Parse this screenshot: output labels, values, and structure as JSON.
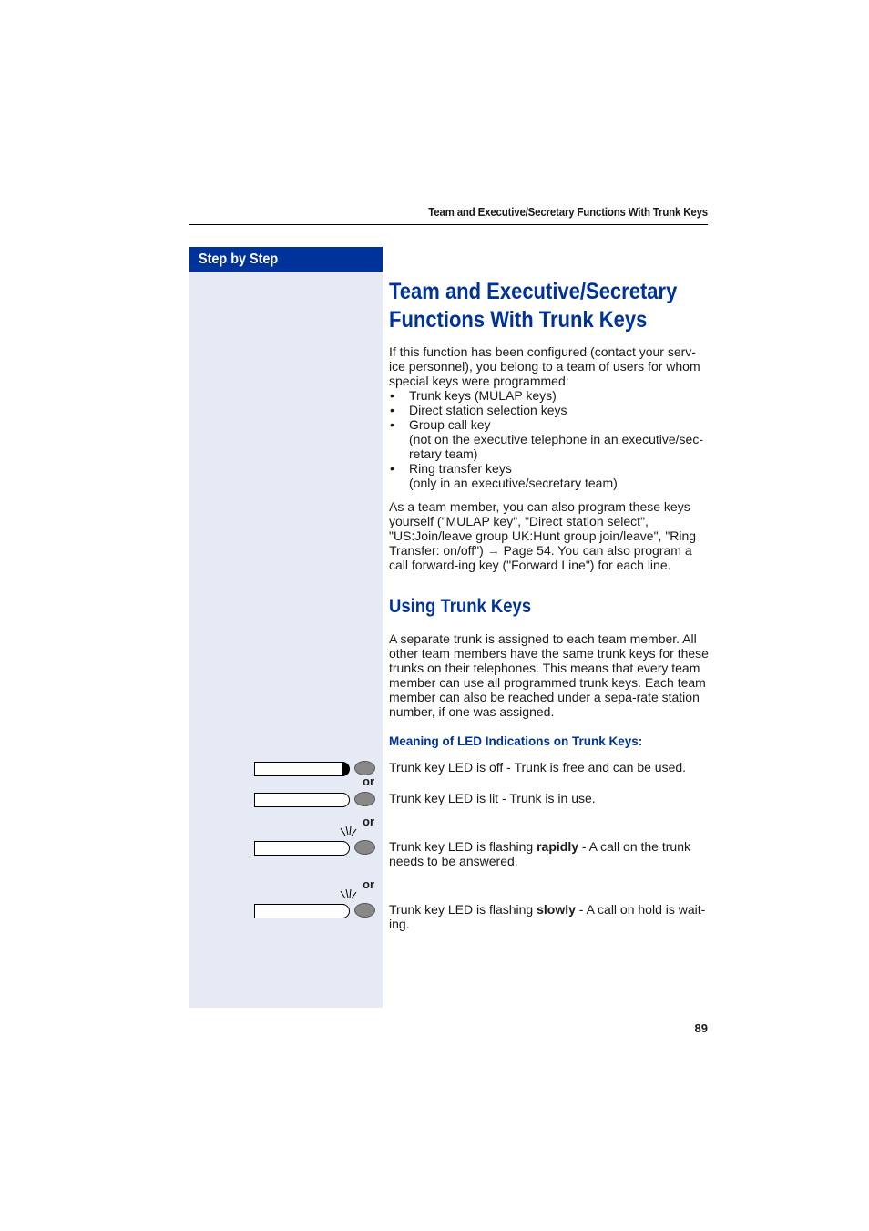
{
  "header": {
    "running_title": "Team and Executive/Secretary Functions With Trunk Keys"
  },
  "sidebar": {
    "tab_label": "Step by Step"
  },
  "section1": {
    "title_line1": "Team and Executive/Secretary",
    "title_line2": "Functions With Trunk Keys",
    "intro": "If this function has been configured (contact your serv-ice personnel), you belong to a team of users for whom special keys were programmed:",
    "bullets": [
      {
        "label": "Trunk keys (MULAP keys)",
        "sub": ""
      },
      {
        "label": "Direct station selection keys",
        "sub": ""
      },
      {
        "label": "Group call key",
        "sub": "(not on the executive telephone in an executive/sec-retary team)"
      },
      {
        "label": "Ring transfer keys",
        "sub": "(only in an executive/secretary team)"
      }
    ],
    "para2_before": "As a team member, you can also program these keys yourself (\"MULAP key\", \"Direct station select\", \"US:Join/leave group UK:Hunt group join/leave\", \"Ring Transfer: on/off\") ",
    "arrow": "→",
    "para2_after": " Page 54. You can also program a call forward-ing key (\"Forward Line\") for each line."
  },
  "section2": {
    "title": "Using Trunk Keys",
    "para": "A separate trunk is assigned to each team member. All other team members have the same trunk keys for these trunks on their telephones. This means that every team member can use all programmed trunk keys. Each team member can also be reached under a sepa-rate station number, if one was assigned.",
    "subheading": "Meaning of LED Indications on Trunk Keys:"
  },
  "led_states": [
    {
      "icon": "led-off",
      "text_before": "Trunk key LED is off - Trunk is free and can be used.",
      "bold": "",
      "text_after": ""
    },
    {
      "icon": "led-lit",
      "text_before": "Trunk key LED is lit - Trunk is in use.",
      "bold": "",
      "text_after": ""
    },
    {
      "icon": "led-flashing-rapid",
      "text_before": "Trunk key LED is flashing ",
      "bold": "rapidly",
      "text_after": " - A call on the trunk needs to be answered."
    },
    {
      "icon": "led-flashing-slow",
      "text_before": "Trunk key LED is flashing ",
      "bold": "slowly",
      "text_after": " - A call on hold is wait-ing."
    }
  ],
  "or_label": "or",
  "page_number": "89"
}
